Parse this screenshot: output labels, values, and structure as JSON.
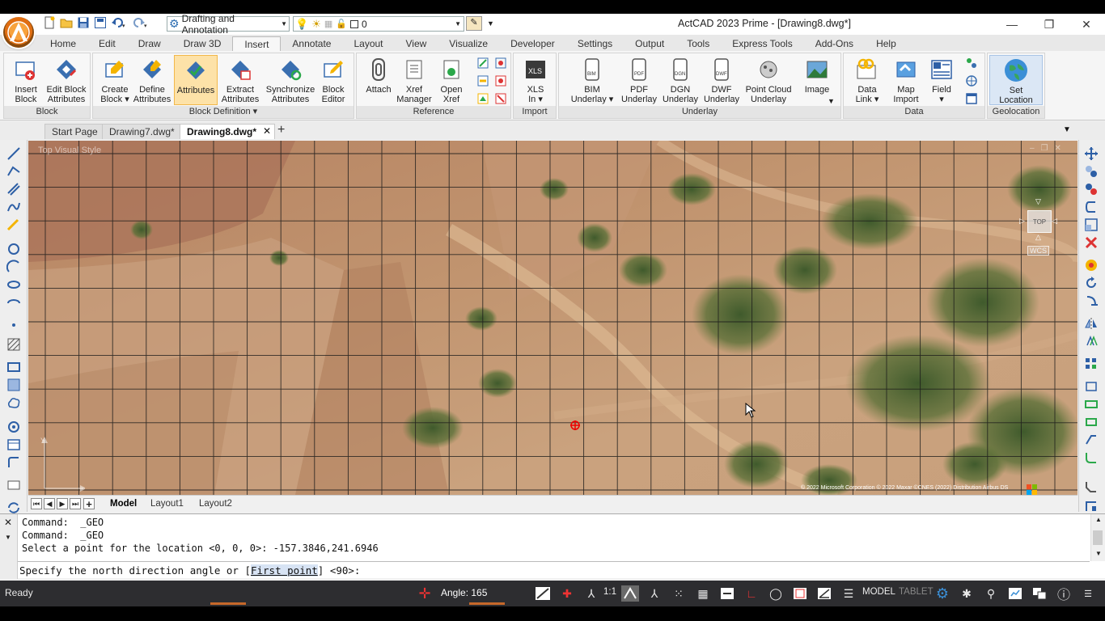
{
  "titlebar": {
    "workspace": "Drafting and Annotation",
    "layer": "0",
    "title": "ActCAD 2023 Prime - [Drawing8.dwg*]"
  },
  "ribbon_tabs": [
    {
      "label": "Home"
    },
    {
      "label": "Edit"
    },
    {
      "label": "Draw"
    },
    {
      "label": "Draw 3D"
    },
    {
      "label": "Insert"
    },
    {
      "label": "Annotate"
    },
    {
      "label": "Layout"
    },
    {
      "label": "View"
    },
    {
      "label": "Visualize"
    },
    {
      "label": "Developer"
    },
    {
      "label": "Settings"
    },
    {
      "label": "Output"
    },
    {
      "label": "Tools"
    },
    {
      "label": "Express Tools"
    },
    {
      "label": "Add-Ons"
    },
    {
      "label": "Help"
    }
  ],
  "ribbon": {
    "block": {
      "title": "Block",
      "insert": "Insert\nBlock",
      "edit_attr": "Edit Block\nAttributes"
    },
    "block_def": {
      "title": "Block Definition ▾",
      "create": "Create\nBlock ▾",
      "define": "Define\nAttributes",
      "attributes": "Attributes",
      "extract": "Extract\nAttributes",
      "sync": "Synchronize\nAttributes",
      "editor": "Block\nEditor"
    },
    "reference": {
      "title": "Reference",
      "attach": "Attach",
      "xref_mgr": "Xref\nManager",
      "open_xref": "Open\nXref"
    },
    "import": {
      "title": "Import",
      "xls": "XLS\nIn ▾"
    },
    "underlay": {
      "title": "Underlay",
      "bim": "BIM\nUnderlay ▾",
      "pdf": "PDF\nUnderlay",
      "dgn": "DGN\nUnderlay",
      "dwf": "DWF\nUnderlay",
      "pointcloud": "Point Cloud\nUnderlay",
      "image": "Image"
    },
    "data": {
      "title": "Data",
      "datalink": "Data\nLink ▾",
      "mapimport": "Map\nImport",
      "field": "Field\n▾"
    },
    "geo": {
      "title": "Geolocation",
      "setloc": "Set\nLocation"
    }
  },
  "doc_tabs": {
    "start": "Start Page",
    "d7": "Drawing7.dwg*",
    "d8": "Drawing8.dwg*"
  },
  "viewport": {
    "label": "Top   Visual Style",
    "viewcube": "TOP",
    "wcs": "WCS",
    "copyright": "© 2022 Microsoft Corporation © 2022 Maxar ©CNES (2022) Distribution Airbus DS",
    "ucs_y": "Y"
  },
  "layout_tabs": {
    "model": "Model",
    "l1": "Layout1",
    "l2": "Layout2"
  },
  "command": {
    "line1": "Command:  _GEO",
    "line2": "Command:  _GEO",
    "line3": "Select a point for the location <0, 0, 0>: -157.3846,241.6946",
    "prompt_before": "Specify the north direction angle or [",
    "prompt_option": "First point",
    "prompt_after": "] <90>:"
  },
  "status": {
    "ready": "Ready",
    "angle": "Angle: 165",
    "scale": "1:1",
    "model": "MODEL",
    "tablet": "TABLET"
  }
}
